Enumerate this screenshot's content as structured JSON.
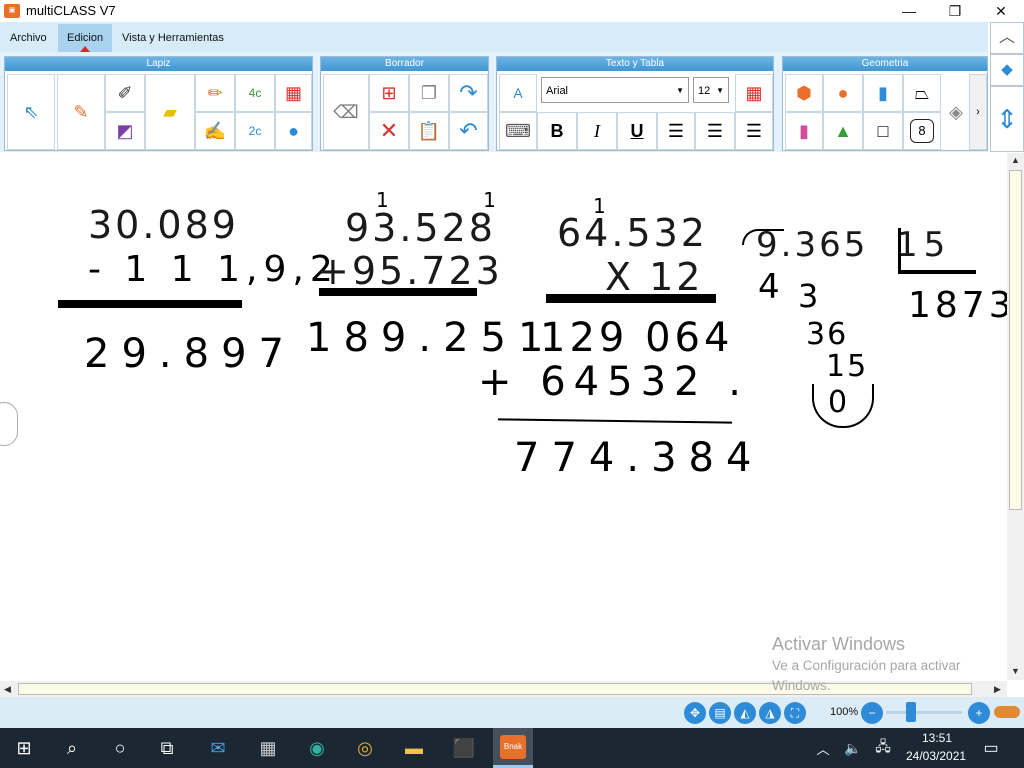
{
  "window": {
    "title": "multiCLASS V7",
    "minimize": "—",
    "maximize": "❐",
    "close": "✕"
  },
  "menu": {
    "items": [
      "Archivo",
      "Edicion",
      "Vista y Herramientas"
    ],
    "active": "Edicion"
  },
  "ribbon": {
    "groups": [
      "Lapiz",
      "Borrador",
      "Texto y Tabla",
      "Geometria"
    ],
    "font": "Arial",
    "font_size": "12",
    "bold": "B",
    "italic": "I",
    "underline": "U",
    "polygon_label": "8"
  },
  "sidenav": {
    "up": "︿",
    "more": "›"
  },
  "canvas": {
    "problem1": {
      "top": "30.089",
      "bottom": "-  1 1 1,9,2",
      "result": "29.897"
    },
    "problem2": {
      "carry": "1   1",
      "top": "93.528",
      "bottom": "+95.723",
      "result": "189.251"
    },
    "problem3": {
      "carry": "1",
      "top": "64.532",
      "bottom": "X 12",
      "partial1": "129 064",
      "partial2": "+ 64532 .",
      "result": "774.384"
    },
    "problem4": {
      "dividend": "9.365",
      "divisor": "15",
      "quotient": "1873",
      "steps": [
        "4",
        "3",
        "36",
        "15",
        "0"
      ]
    }
  },
  "watermark": {
    "line1": "Activar Windows",
    "line2": "Ve a Configuración para activar",
    "line3": "Windows."
  },
  "status": {
    "zoom": "100%",
    "minus": "−",
    "plus": "+"
  },
  "taskbar": {
    "time": "13:51",
    "date": "24/03/2021",
    "active_app_label": "Bnak"
  }
}
